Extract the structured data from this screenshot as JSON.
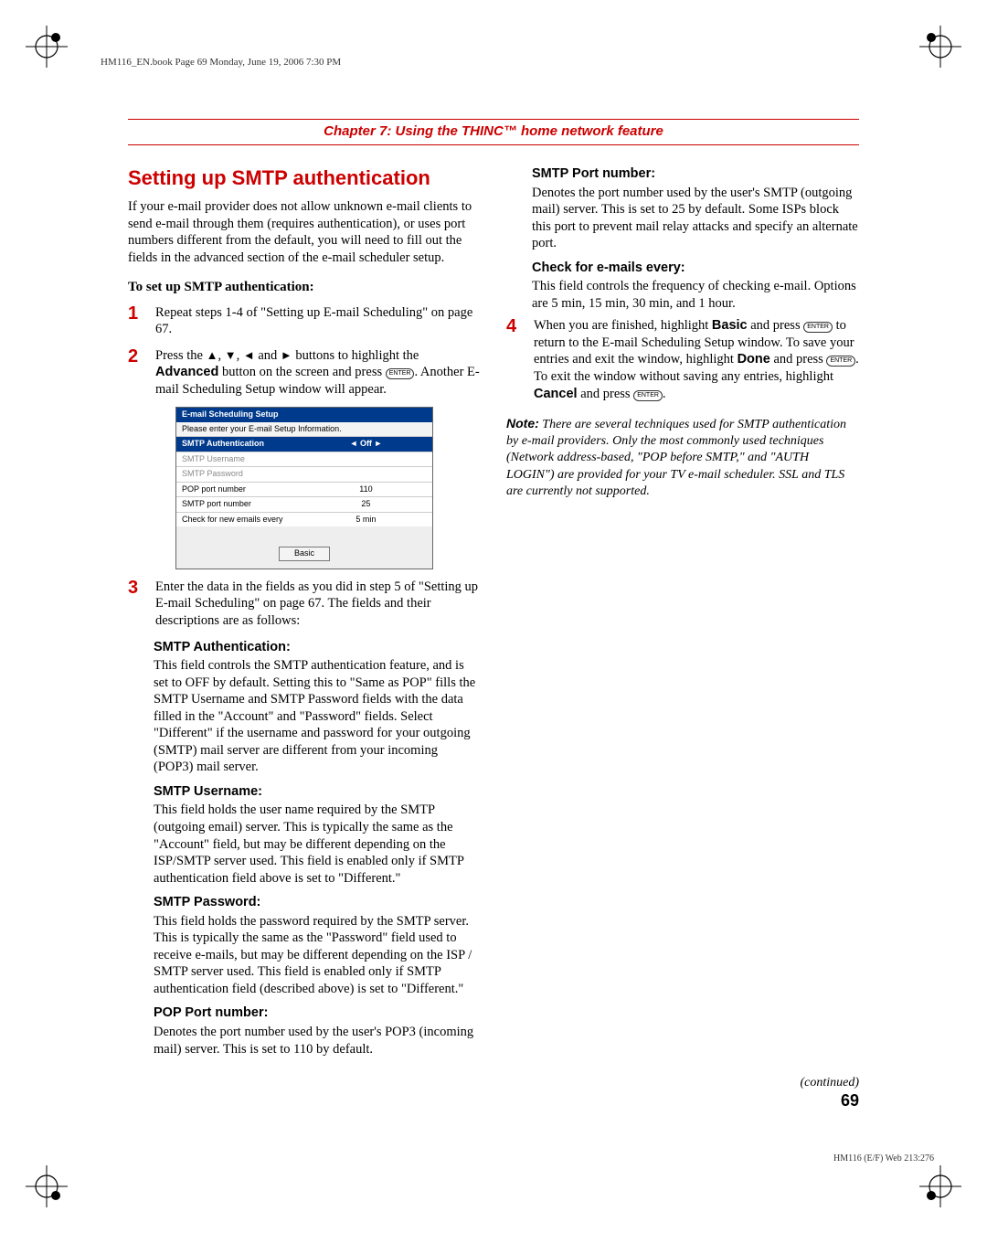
{
  "header_line": "HM116_EN.book  Page 69  Monday, June 19, 2006  7:30 PM",
  "chapter": "Chapter 7: Using the THINC™ home network feature",
  "section_title": "Setting up SMTP authentication",
  "intro": "If your e-mail provider does not allow unknown e-mail clients to send e-mail through them (requires authentication), or uses port numbers different from the default, you will need to fill out the fields in the advanced section of the e-mail scheduler setup.",
  "subhead": "To set up SMTP authentication:",
  "steps": {
    "1": "Repeat steps 1-4 of \"Setting up E-mail Scheduling\" on page 67.",
    "2_pre": "Press the ",
    "2_mid": " buttons to highlight the ",
    "2_after": " button on the screen and press ",
    "2_end": ". Another E-mail Scheduling Setup window will appear.",
    "3": "Enter the data in the fields as you did in step 5 of \"Setting up E-mail Scheduling\" on page 67. The fields and their descriptions are as follows:",
    "4_pre": "When you are finished, highlight ",
    "4_mid1": " and press ",
    "4_mid2": " to return to the E-mail Scheduling Setup window. To save your entries and exit the window, highlight ",
    "4_mid3": " and press ",
    "4_mid4": ". To exit the window without saving any entries, highlight ",
    "4_end": " and press "
  },
  "labels": {
    "advanced": "Advanced",
    "basic": "Basic",
    "done": "Done",
    "cancel": "Cancel",
    "enter": "ENTER"
  },
  "fields_left": [
    {
      "h": "SMTP Authentication:",
      "b": "This field controls the SMTP authentication feature, and is set to OFF by default. Setting this to \"Same as POP\" fills the SMTP Username and SMTP Password fields with the data filled in the \"Account\" and \"Password\" fields. Select \"Different\" if the username and password for your outgoing (SMTP) mail server are different from your incoming (POP3) mail server."
    },
    {
      "h": "SMTP Username:",
      "b": "This field holds the user name required by the SMTP (outgoing email) server. This is typically the same as the \"Account\" field, but may be different depending on the ISP/SMTP server used. This field is enabled only if SMTP authentication field above is set to \"Different.\""
    },
    {
      "h": "SMTP Password:",
      "b": "This field holds the password required by the SMTP server. This is typically the same as the \"Password\" field used to receive e-mails, but may be different depending on the ISP / SMTP server used. This field is enabled only if SMTP authentication field (described above) is set to \"Different.\""
    },
    {
      "h": "POP Port number:",
      "b": "Denotes the port number used by the user's POP3 (incoming mail) server. This is set to 110 by default."
    }
  ],
  "fields_right": [
    {
      "h": "SMTP Port number:",
      "b": "Denotes the port number used by the user's SMTP (outgoing mail) server. This is set to 25 by default. Some ISPs block this port to prevent mail relay attacks and specify an alternate port."
    },
    {
      "h": "Check for e-mails every:",
      "b": "This field controls the frequency of checking e-mail. Options are 5 min, 15 min, 30 min, and 1 hour."
    }
  ],
  "note_label": "Note:",
  "note_body": " There are several techniques used for SMTP authentication by e-mail providers. Only the most commonly used techniques (Network address-based, \"POP before SMTP,\" and \"AUTH LOGIN\") are provided for your TV e-mail scheduler. SSL and TLS are currently not supported.",
  "setup": {
    "title": "E-mail Scheduling Setup",
    "sub": "Please enter your E-mail Setup Information.",
    "rows": [
      {
        "l": "SMTP Authentication",
        "r": "◄           Off           ►",
        "hl": true
      },
      {
        "l": "SMTP Username",
        "r": "",
        "dim": true
      },
      {
        "l": "SMTP Password",
        "r": "",
        "dim": true
      },
      {
        "l": "POP port number",
        "r": "110"
      },
      {
        "l": "SMTP port number",
        "r": "25"
      },
      {
        "l": "Check for new emails every",
        "r": "5 min"
      }
    ],
    "btn": "Basic"
  },
  "continued": "(continued)",
  "pagenum": "69",
  "footcode": "HM116 (E/F) Web 213:276"
}
